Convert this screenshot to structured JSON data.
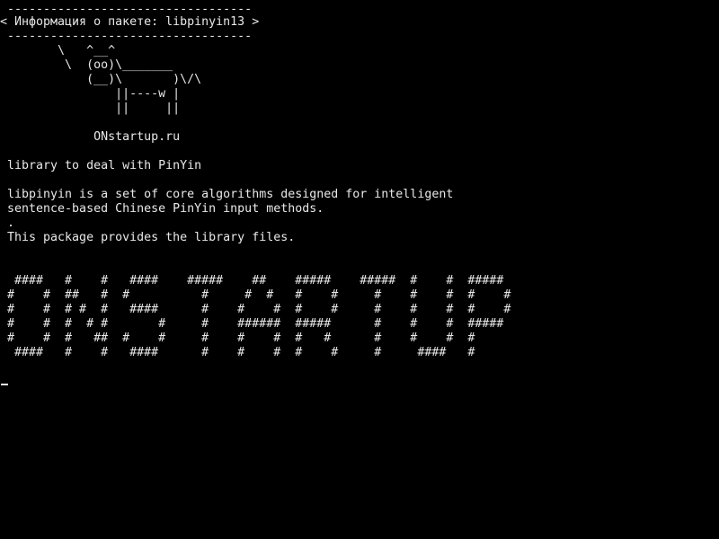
{
  "terminal": {
    "cowsay": {
      "top_border": " ----------------------------------",
      "message": "< Информация о пакете: libpinyin13 >",
      "bottom_border": " ----------------------------------",
      "cow_line_1": "        \\   ^__^",
      "cow_line_2": "         \\  (oo)\\_______",
      "cow_line_3": "            (__)\\       )\\/\\",
      "cow_line_4": "                ||----w |",
      "cow_line_5": "                ||     ||",
      "site_label": "             ONstartup.ru"
    },
    "package": {
      "summary": " library to deal with PinYin",
      "description_line_1": " libpinyin is a set of core algorithms designed for intelligent",
      "description_line_2": " sentence-based Chinese PinYin input methods.",
      "description_line_3": " .",
      "description_line_4": " This package provides the library files."
    },
    "banner": {
      "row_1": "  ####   #    #   ####    #####    ##    #####    #####  #    #  #####",
      "row_2": " #    #  ##   #  #          #     #  #   #    #     #    #    #  #    #",
      "row_3": " #    #  # #  #   ####      #    #    #  #    #     #    #    #  #    #",
      "row_4": " #    #  #  # #       #     #    ######  #####      #    #    #  #####",
      "row_5": " #    #  #   ##  #    #     #    #    #  #   #      #    #    #  #",
      "row_6": "  ####   #    #   ####      #    #    #  #    #     #     ####   #"
    },
    "colors": {
      "background": "#000000",
      "text": "#e8e8e8"
    }
  }
}
